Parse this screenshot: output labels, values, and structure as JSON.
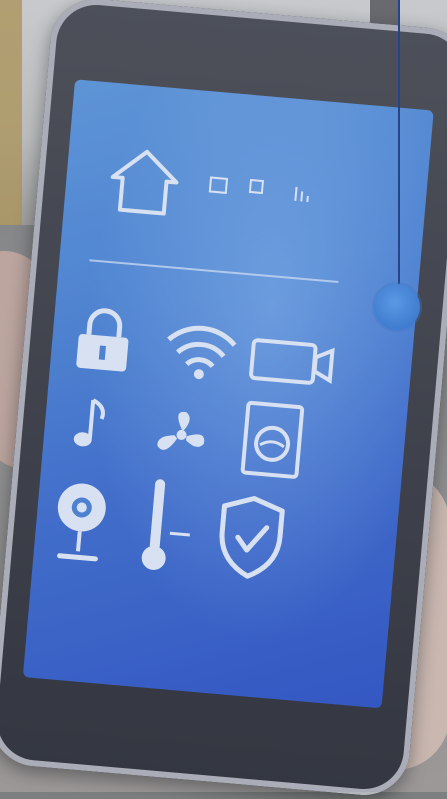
{
  "scene": {
    "subject": "smart-home-app-on-phone",
    "accent_color": "#4d86d9",
    "icons": [
      "house-icon",
      "status-bar-icons",
      "lock-icon",
      "wifi-icon",
      "camera-battery-icon",
      "music-note-icon",
      "fan-icon",
      "washing-machine-icon",
      "webcam-icon",
      "thermometer-icon",
      "shield-check-icon"
    ]
  }
}
